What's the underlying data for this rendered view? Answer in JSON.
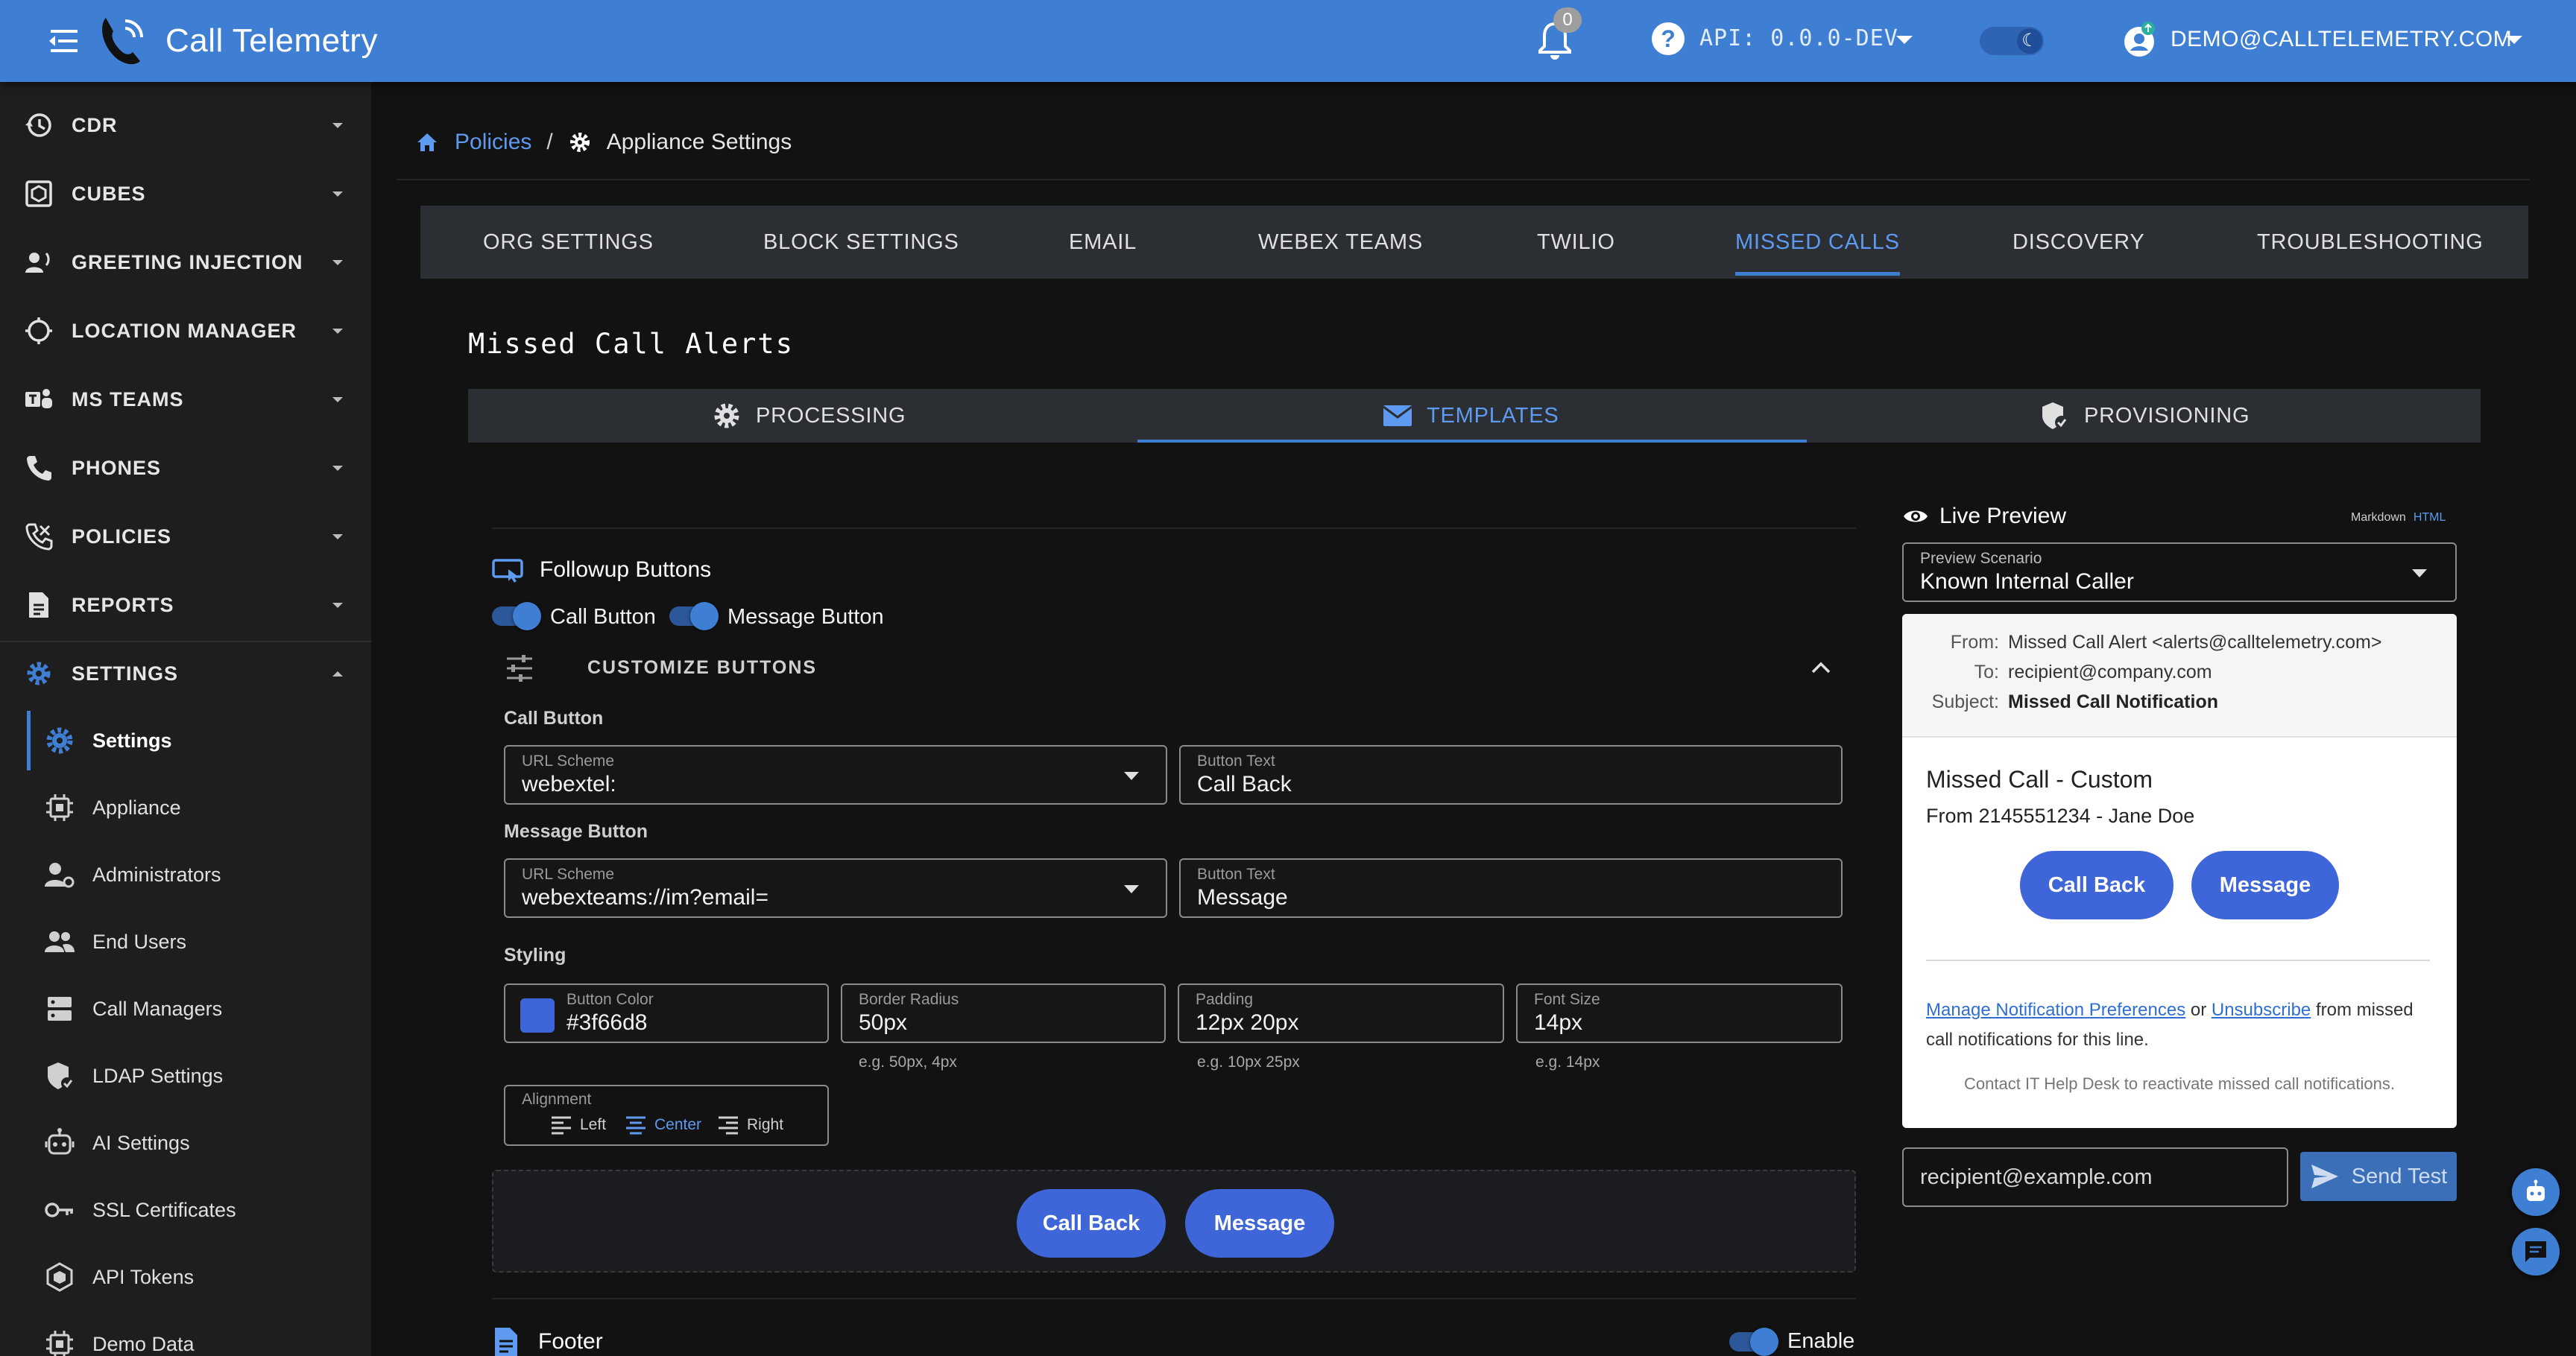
{
  "app": {
    "title": "Call Telemetry",
    "notification_count": "0",
    "api_version": "API: 0.0.0-DEV",
    "user_email": "DEMO@CALLTELEMETRY.COM"
  },
  "sidebar": {
    "items": [
      {
        "label": "CDR",
        "icon": "history-icon"
      },
      {
        "label": "CUBES",
        "icon": "cube-icon"
      },
      {
        "label": "GREETING INJECTION",
        "icon": "voice-icon"
      },
      {
        "label": "LOCATION MANAGER",
        "icon": "crosshair-icon"
      },
      {
        "label": "MS TEAMS",
        "icon": "teams-icon"
      },
      {
        "label": "PHONES",
        "icon": "phone-icon"
      },
      {
        "label": "POLICIES",
        "icon": "phone-policy-icon"
      },
      {
        "label": "REPORTS",
        "icon": "report-icon"
      },
      {
        "label": "SETTINGS",
        "icon": "gear-icon"
      }
    ],
    "settings_children": [
      {
        "label": "Settings",
        "icon": "gear-icon"
      },
      {
        "label": "Appliance",
        "icon": "chip-icon"
      },
      {
        "label": "Administrators",
        "icon": "admin-icon"
      },
      {
        "label": "End Users",
        "icon": "group-icon"
      },
      {
        "label": "Call Managers",
        "icon": "server-icon"
      },
      {
        "label": "LDAP Settings",
        "icon": "shield-icon"
      },
      {
        "label": "AI Settings",
        "icon": "robot-icon"
      },
      {
        "label": "SSL Certificates",
        "icon": "key-icon"
      },
      {
        "label": "API Tokens",
        "icon": "api-icon"
      },
      {
        "label": "Demo Data",
        "icon": "chip-icon"
      }
    ]
  },
  "breadcrumb": {
    "parent": "Policies",
    "separator": "/",
    "current": "Appliance Settings"
  },
  "tabs": [
    "ORG SETTINGS",
    "BLOCK SETTINGS",
    "EMAIL",
    "WEBEX TEAMS",
    "TWILIO",
    "MISSED CALLS",
    "DISCOVERY",
    "TROUBLESHOOTING"
  ],
  "active_tab": "MISSED CALLS",
  "section_title": "Missed Call Alerts",
  "subtabs": [
    "PROCESSING",
    "TEMPLATES",
    "PROVISIONING"
  ],
  "active_subtab": "TEMPLATES",
  "followup": {
    "title": "Followup Buttons",
    "call_toggle_label": "Call Button",
    "message_toggle_label": "Message Button",
    "customize_label": "CUSTOMIZE BUTTONS",
    "call_group": "Call Button",
    "message_group": "Message Button",
    "styling_group": "Styling",
    "call_url_label": "URL Scheme",
    "call_url_value": "webextel:",
    "call_text_label": "Button Text",
    "call_text_value": "Call Back",
    "msg_url_label": "URL Scheme",
    "msg_url_value": "webexteams://im?email=",
    "msg_text_label": "Button Text",
    "msg_text_value": "Message",
    "color_label": "Button Color",
    "color_value": "#3f66d8",
    "radius_label": "Border Radius",
    "radius_value": "50px",
    "radius_help": "e.g. 50px, 4px",
    "padding_label": "Padding",
    "padding_value": "12px 20px",
    "padding_help": "e.g. 10px 25px",
    "font_label": "Font Size",
    "font_value": "14px",
    "font_help": "e.g. 14px",
    "alignment_label": "Alignment",
    "align_left": "Left",
    "align_center": "Center",
    "align_right": "Right",
    "preview_call": "Call Back",
    "preview_message": "Message"
  },
  "footer": {
    "title": "Footer",
    "enable_label": "Enable"
  },
  "live_preview": {
    "title": "Live Preview",
    "mode_markdown": "Markdown",
    "mode_html": "HTML",
    "scenario_label": "Preview Scenario",
    "scenario_value": "Known Internal Caller",
    "from_key": "From:",
    "from_val": "Missed Call Alert <alerts@calltelemetry.com>",
    "to_key": "To:",
    "to_val": "recipient@company.com",
    "subject_key": "Subject:",
    "subject_val": "Missed Call Notification",
    "body_title": "Missed Call - Custom",
    "body_from": "From 2145551234 - Jane Doe",
    "btn_call": "Call Back",
    "btn_message": "Message",
    "link_manage": "Manage Notification Preferences",
    "link_or": "or",
    "link_unsub": "Unsubscribe",
    "link_tail": "from missed call notifications for this line.",
    "note": "Contact IT Help Desk to reactivate missed call notifications.",
    "recipient_placeholder": "recipient@example.com",
    "send_label": "Send Test"
  },
  "colors": {
    "primary": "#3f7fd3",
    "button": "#3f66d8",
    "link": "#5d9af0"
  }
}
